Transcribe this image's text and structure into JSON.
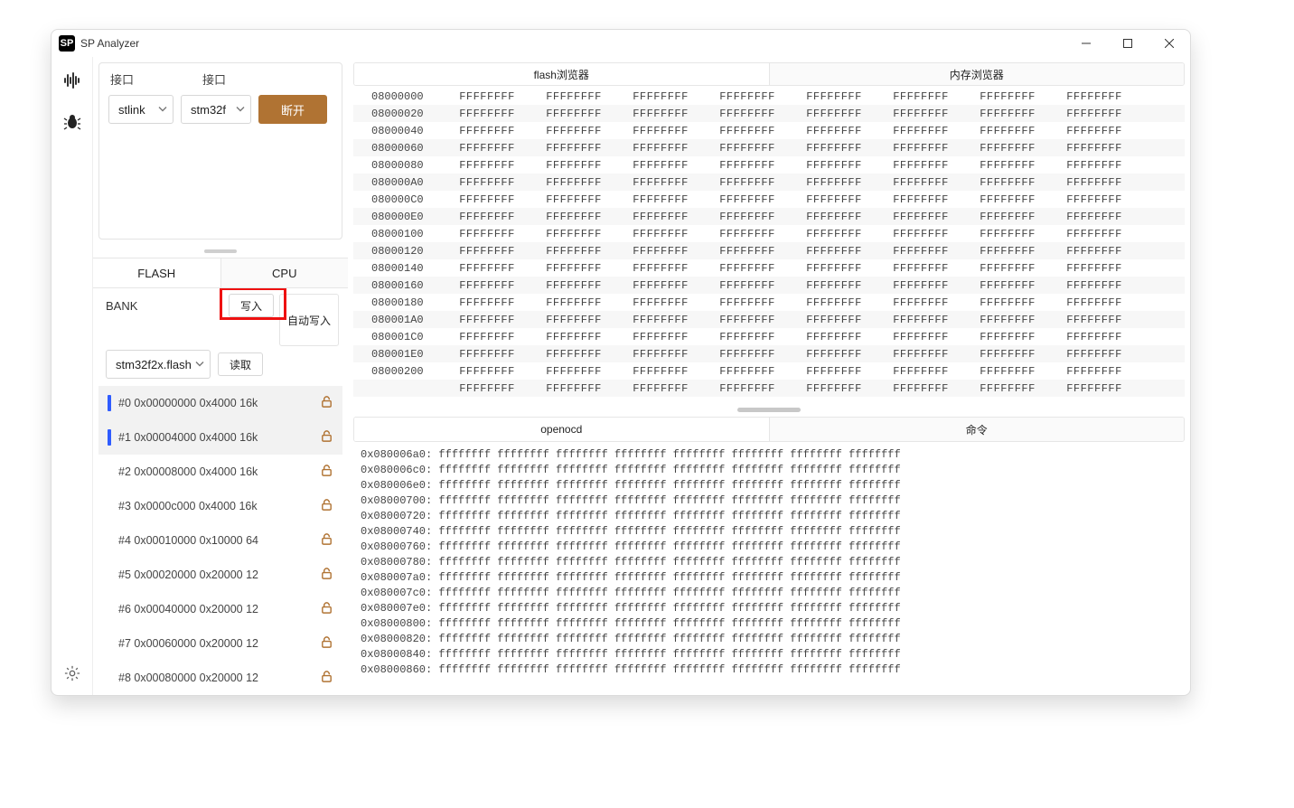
{
  "app": {
    "icon": "SP",
    "title": "SP Analyzer"
  },
  "conn": {
    "label1": "接口",
    "label2": "接口",
    "sel1": "stlink",
    "sel2": "stm32f",
    "disconnect": "断开"
  },
  "leftTabs": {
    "flash": "FLASH",
    "cpu": "CPU"
  },
  "bank": {
    "title": "BANK",
    "write": "写入",
    "read": "读取",
    "autoWrite": "自动写入",
    "select": "stm32f2x.flash"
  },
  "sectors": [
    {
      "sel": true,
      "text": "#0 0x00000000 0x4000 16k"
    },
    {
      "sel": true,
      "text": "#1 0x00004000 0x4000 16k"
    },
    {
      "sel": false,
      "text": "#2 0x00008000 0x4000 16k"
    },
    {
      "sel": false,
      "text": "#3 0x0000c000 0x4000 16k"
    },
    {
      "sel": false,
      "text": "#4 0x00010000 0x10000 64"
    },
    {
      "sel": false,
      "text": "#5 0x00020000 0x20000 12"
    },
    {
      "sel": false,
      "text": "#6 0x00040000 0x20000 12"
    },
    {
      "sel": false,
      "text": "#7 0x00060000 0x20000 12"
    },
    {
      "sel": false,
      "text": "#8 0x00080000 0x20000 12"
    }
  ],
  "topTabs": {
    "flash": "flash浏览器",
    "mem": "内存浏览器"
  },
  "hex": {
    "addrs": [
      "08000000",
      "08000020",
      "08000040",
      "08000060",
      "08000080",
      "080000A0",
      "080000C0",
      "080000E0",
      "08000100",
      "08000120",
      "08000140",
      "08000160",
      "08000180",
      "080001A0",
      "080001C0",
      "080001E0",
      "08000200",
      ""
    ],
    "cell": "FFFFFFFF",
    "cols": 8
  },
  "bottomTabs": {
    "openocd": "openocd",
    "cmd": "命令"
  },
  "log": {
    "addrs": [
      "0x080006a0",
      "0x080006c0",
      "0x080006e0",
      "0x08000700",
      "0x08000720",
      "0x08000740",
      "0x08000760",
      "0x08000780",
      "0x080007a0",
      "0x080007c0",
      "0x080007e0",
      "0x08000800",
      "0x08000820",
      "0x08000840",
      "0x08000860"
    ],
    "word": "ffffffff",
    "words": 8
  }
}
